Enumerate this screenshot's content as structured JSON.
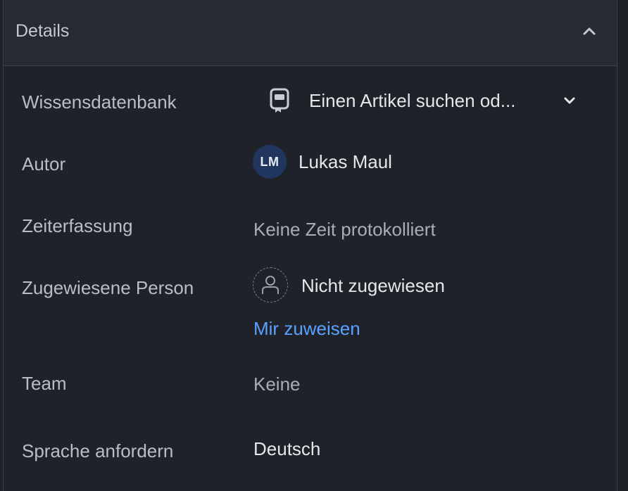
{
  "header": {
    "title": "Details",
    "collapse_icon": "chevron-up-icon"
  },
  "rows": {
    "knowledge_base": {
      "label": "Wissensdatenbank",
      "placeholder": "Einen Artikel suchen od...",
      "icon": "book-icon",
      "dropdown_icon": "chevron-down-icon"
    },
    "author": {
      "label": "Autor",
      "initials": "LM",
      "name": "Lukas Maul"
    },
    "time_tracking": {
      "label": "Zeiterfassung",
      "value": "Keine Zeit protokolliert"
    },
    "assignee": {
      "label": "Zugewiesene Person",
      "value": "Nicht zugewiesen",
      "action": "Mir zuweisen",
      "icon": "person-icon"
    },
    "team": {
      "label": "Team",
      "value": "Keine"
    },
    "language": {
      "label": "Sprache anfordern",
      "value": "Deutsch"
    }
  },
  "colors": {
    "background": "#1f2228",
    "header_background": "#262a31",
    "link": "#5aa2ff",
    "avatar": "#20365e"
  }
}
